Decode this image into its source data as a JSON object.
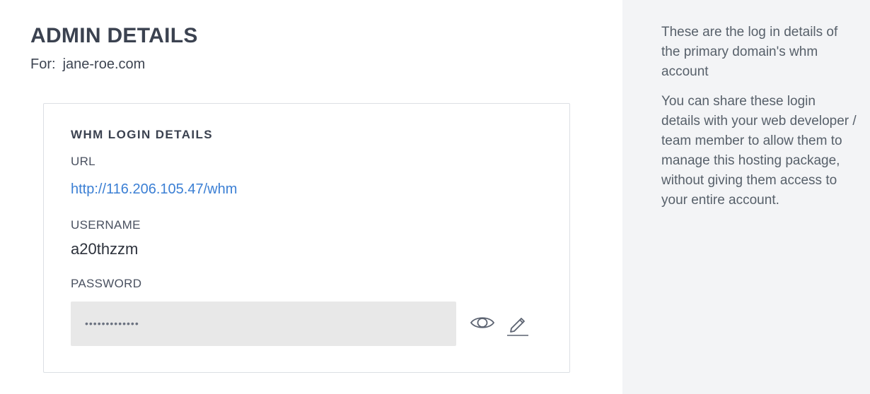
{
  "header": {
    "title": "ADMIN DETAILS",
    "for_label": "For:",
    "domain": "jane-roe.com"
  },
  "card": {
    "title": "WHM LOGIN DETAILS",
    "url_label": "URL",
    "url_value": "http://116.206.105.47/whm",
    "username_label": "USERNAME",
    "username_value": "a20thzzm",
    "password_label": "PASSWORD",
    "password_masked": "•••••••••••••",
    "icons": {
      "show": "eye-icon",
      "edit": "pencil-icon"
    }
  },
  "aside": {
    "paragraph_1": "These are the log in details of the primary domain's whm account",
    "paragraph_2": "You can share these login details with your web developer / team member to allow them to manage this hosting package, without giving them access to your entire account."
  },
  "colors": {
    "link": "#3b7fd4",
    "heading": "#3b4250",
    "aside_bg": "#f3f4f6",
    "field_bg": "#e8e8e8"
  }
}
